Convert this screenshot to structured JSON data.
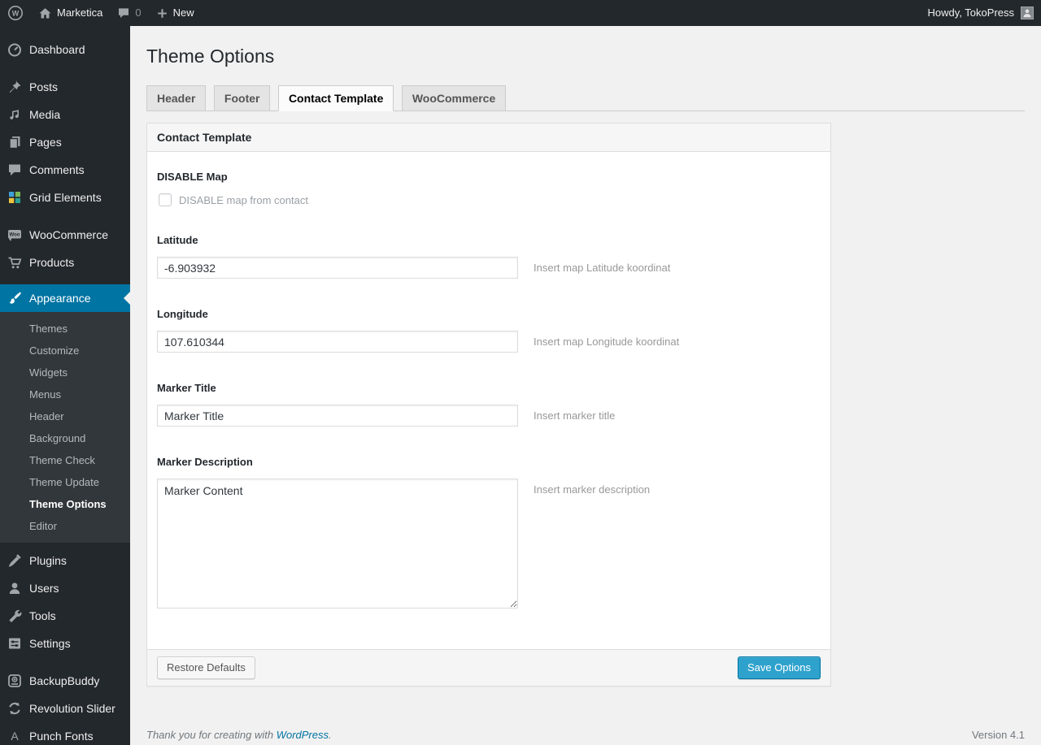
{
  "admin_bar": {
    "site_name": "Marketica",
    "comment_count": "0",
    "new_label": "New",
    "howdy": "Howdy, TokoPress"
  },
  "sidebar": {
    "items": [
      {
        "label": "Dashboard",
        "icon": "dashboard-icon"
      },
      {
        "label": "Posts",
        "icon": "pushpin-icon"
      },
      {
        "label": "Media",
        "icon": "media-icon"
      },
      {
        "label": "Pages",
        "icon": "pages-icon"
      },
      {
        "label": "Comments",
        "icon": "comment-icon"
      },
      {
        "label": "Grid Elements",
        "icon": "grid-elements-icon"
      },
      {
        "label": "WooCommerce",
        "icon": "woocommerce-icon"
      },
      {
        "label": "Products",
        "icon": "cart-icon"
      },
      {
        "label": "Appearance",
        "icon": "paintbrush-icon",
        "current": true
      },
      {
        "label": "Plugins",
        "icon": "plugin-icon"
      },
      {
        "label": "Users",
        "icon": "user-icon"
      },
      {
        "label": "Tools",
        "icon": "wrench-icon"
      },
      {
        "label": "Settings",
        "icon": "settings-icon"
      },
      {
        "label": "BackupBuddy",
        "icon": "backup-icon"
      },
      {
        "label": "Revolution Slider",
        "icon": "refresh-icon"
      },
      {
        "label": "Punch Fonts",
        "icon": "letter-a-icon"
      }
    ],
    "appearance_submenu": [
      {
        "label": "Themes"
      },
      {
        "label": "Customize"
      },
      {
        "label": "Widgets"
      },
      {
        "label": "Menus"
      },
      {
        "label": "Header"
      },
      {
        "label": "Background"
      },
      {
        "label": "Theme Check"
      },
      {
        "label": "Theme Update"
      },
      {
        "label": "Theme Options",
        "current": true
      },
      {
        "label": "Editor"
      }
    ]
  },
  "main": {
    "page_title": "Theme Options",
    "tabs": [
      {
        "label": "Header"
      },
      {
        "label": "Footer"
      },
      {
        "label": "Contact Template",
        "active": true
      },
      {
        "label": "WooCommerce"
      }
    ],
    "panel": {
      "heading": "Contact Template",
      "disable_map": {
        "label": "DISABLE Map",
        "checkbox_label": "DISABLE map from contact",
        "checked": false
      },
      "latitude": {
        "label": "Latitude",
        "value": "-6.903932",
        "hint": "Insert map Latitude koordinat"
      },
      "longitude": {
        "label": "Longitude",
        "value": "107.610344",
        "hint": "Insert map Longitude koordinat"
      },
      "marker_title": {
        "label": "Marker Title",
        "value": "Marker Title",
        "hint": "Insert marker title"
      },
      "marker_description": {
        "label": "Marker Description",
        "value": "Marker Content",
        "hint": "Insert marker description"
      },
      "restore_button": "Restore Defaults",
      "save_button": "Save Options"
    }
  },
  "footer": {
    "thanks_text": "Thank you for creating with",
    "link_text": "WordPress",
    "period": ".",
    "version": "Version 4.1"
  },
  "icons": {
    "wp_logo_letter": "W",
    "woo_badge": "Woo",
    "punch_fonts_letter": "A"
  },
  "colors": {
    "admin_dark": "#23282d",
    "submenu_bg": "#32373c",
    "accent_blue": "#0074a2",
    "button_primary": "#2ea2cc",
    "page_bg": "#f1f1f1",
    "link": "#0074a2"
  }
}
